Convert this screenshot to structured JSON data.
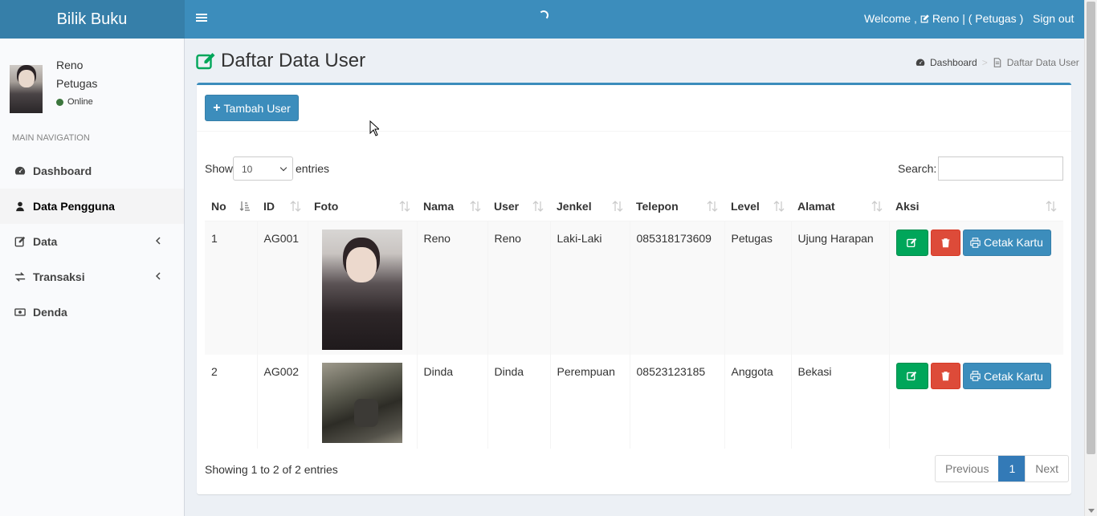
{
  "app": {
    "title": "Bilik Buku"
  },
  "header": {
    "welcome": "Welcome ,",
    "user": "Reno | ( Petugas )",
    "signout": "Sign out"
  },
  "user_panel": {
    "name": "Reno",
    "role": "Petugas",
    "status": "Online"
  },
  "sidebar": {
    "nav_header": "MAIN NAVIGATION",
    "items": [
      {
        "label": "Dashboard",
        "icon": "dashboard-icon"
      },
      {
        "label": "Data Pengguna",
        "icon": "user-icon",
        "active": true
      },
      {
        "label": "Data",
        "icon": "edit-icon",
        "expandable": true
      },
      {
        "label": "Transaksi",
        "icon": "exchange-icon",
        "expandable": true
      },
      {
        "label": "Denda",
        "icon": "money-icon"
      }
    ]
  },
  "page": {
    "title": "Daftar Data User"
  },
  "breadcrumb": {
    "home": "Dashboard",
    "current": "Daftar Data User"
  },
  "toolbar": {
    "add_label": "Tambah User"
  },
  "datatable": {
    "show_label": "Show",
    "entries_value": "10",
    "entries_label": "entries",
    "search_label": "Search:",
    "search_value": "",
    "columns": [
      "No",
      "ID",
      "Foto",
      "Nama",
      "User",
      "Jenkel",
      "Telepon",
      "Level",
      "Alamat",
      "Aksi"
    ],
    "rows": [
      {
        "no": "1",
        "id": "AG001",
        "nama": "Reno",
        "user": "Reno",
        "jenkel": "Laki-Laki",
        "telepon": "085318173609",
        "level": "Petugas",
        "alamat": "Ujung Harapan"
      },
      {
        "no": "2",
        "id": "AG002",
        "nama": "Dinda",
        "user": "Dinda",
        "jenkel": "Perempuan",
        "telepon": "08523123185",
        "level": "Anggota",
        "alamat": "Bekasi"
      }
    ],
    "print_label": "Cetak Kartu",
    "info": "Showing 1 to 2 of 2 entries",
    "pagination": {
      "previous": "Previous",
      "current": "1",
      "next": "Next"
    }
  },
  "colors": {
    "primary": "#3c8dbc",
    "success": "#00a65a",
    "danger": "#dd4b39"
  }
}
